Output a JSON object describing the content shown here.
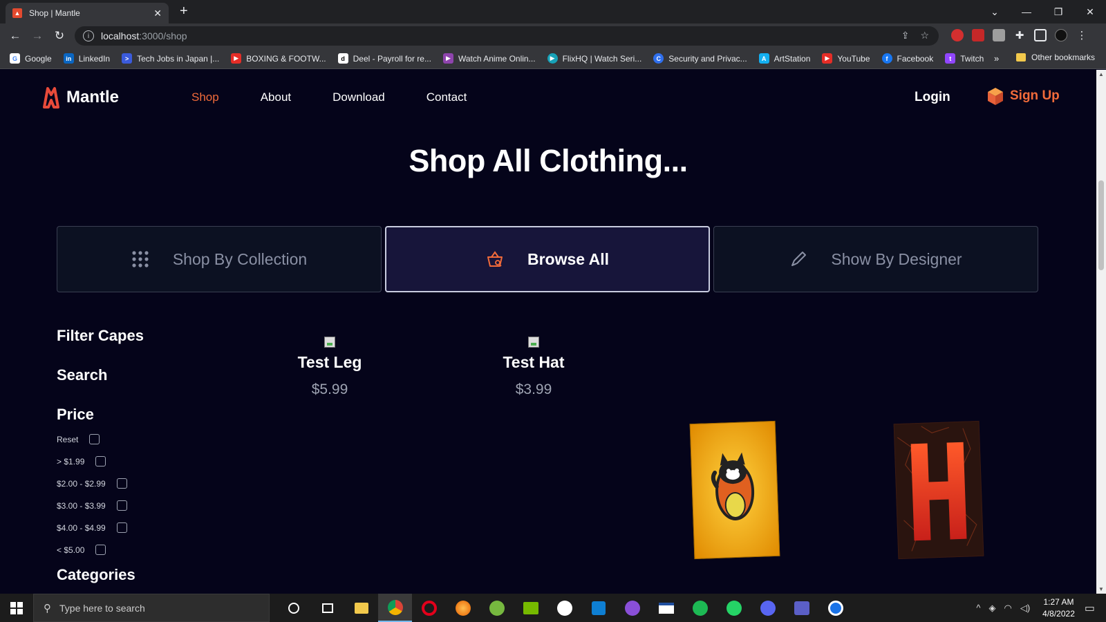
{
  "browser": {
    "tab_title": "Shop | Mantle",
    "url_host": "localhost",
    "url_path": ":3000/shop",
    "bookmarks": [
      {
        "label": "Google",
        "color": "#4285f4",
        "glyph": "G"
      },
      {
        "label": "LinkedIn",
        "color": "#0a66c2",
        "glyph": "in"
      },
      {
        "label": "Tech Jobs in Japan |...",
        "color": "#3b5bdb",
        "glyph": ">"
      },
      {
        "label": "BOXING & FOOTW...",
        "color": "#e52d27",
        "glyph": "▶"
      },
      {
        "label": "Deel - Payroll for re...",
        "color": "#ffffff",
        "glyph": "d"
      },
      {
        "label": "Watch Anime Onlin...",
        "color": "#8e44ad",
        "glyph": "▶"
      },
      {
        "label": "FlixHQ | Watch Seri...",
        "color": "#17a2b8",
        "glyph": "▶"
      },
      {
        "label": "Security and Privac...",
        "color": "#2f6fed",
        "glyph": "C"
      },
      {
        "label": "ArtStation",
        "color": "#13aff0",
        "glyph": "A"
      },
      {
        "label": "YouTube",
        "color": "#e52d27",
        "glyph": "▶"
      },
      {
        "label": "Facebook",
        "color": "#1877f2",
        "glyph": "f"
      },
      {
        "label": "Twitch",
        "color": "#9146ff",
        "glyph": "t"
      }
    ],
    "other_bookmarks": "Other bookmarks"
  },
  "site": {
    "brand": "Mantle",
    "accent": "#f26b3a",
    "nav": [
      "Shop",
      "About",
      "Download",
      "Contact"
    ],
    "active_nav": "Shop",
    "login": "Login",
    "signup": "Sign Up"
  },
  "heading": "Shop All Clothing...",
  "tabs": [
    {
      "label": "Shop By Collection",
      "icon": "grid-icon",
      "active": false
    },
    {
      "label": "Browse All",
      "icon": "basket-icon",
      "active": true
    },
    {
      "label": "Show By Designer",
      "icon": "pen-icon",
      "active": false
    }
  ],
  "filters": {
    "title": "Filter Capes",
    "search": "Search",
    "price": "Price",
    "price_options": [
      "Reset",
      "> $1.99",
      "$2.00 - $2.99",
      "$3.00 - $3.99",
      "$4.00 - $4.99",
      "< $5.00"
    ],
    "categories": "Categories"
  },
  "products": [
    {
      "name": "Test Leg",
      "price": "$5.99"
    },
    {
      "name": "Test Hat",
      "price": "$3.99"
    }
  ],
  "taskbar": {
    "search_placeholder": "Type here to search",
    "time": "1:27 AM",
    "date": "4/8/2022"
  }
}
